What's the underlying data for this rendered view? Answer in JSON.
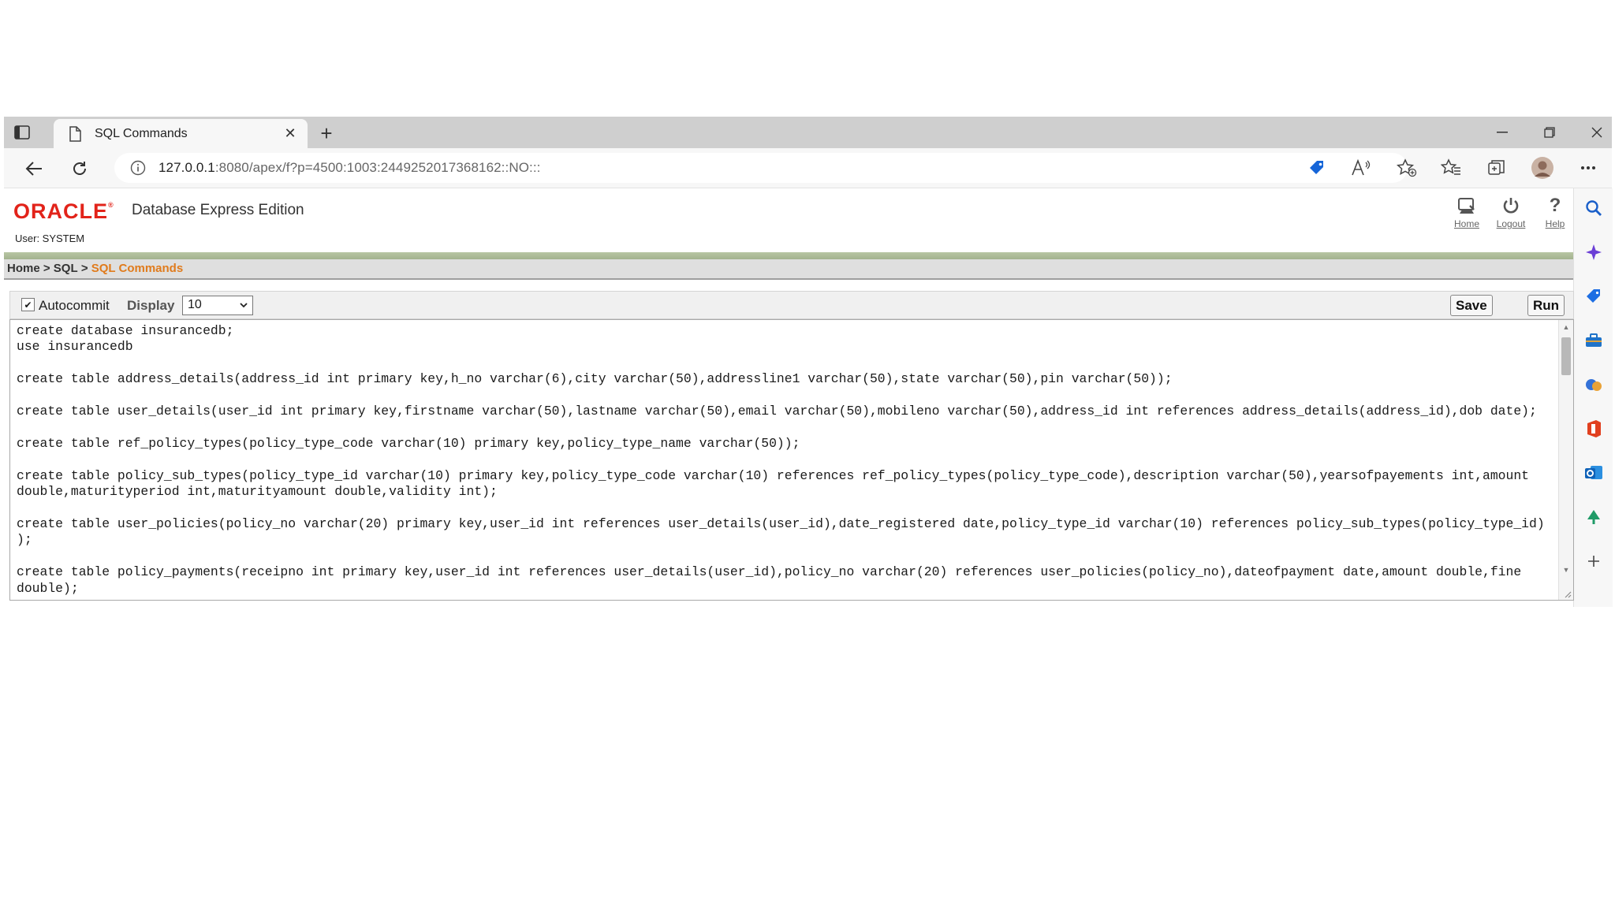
{
  "browser": {
    "tab_title": "SQL Commands",
    "url_host": "127.0.0.1",
    "url_rest": ":8080/apex/f?p=4500:1003:2449252017368162::NO:::"
  },
  "header": {
    "brand": "ORACLE",
    "product": "Database Express Edition",
    "user": "User: SYSTEM",
    "home_label": "Home",
    "logout_label": "Logout",
    "help_label": "Help"
  },
  "breadcrumb": {
    "home": "Home",
    "sep": ">",
    "sql": "SQL",
    "current": "SQL Commands"
  },
  "commands": {
    "autocommit_label": "Autocommit",
    "autocommit_checked": true,
    "display_label": "Display",
    "display_value": "10",
    "save_label": "Save",
    "run_label": "Run"
  },
  "editor": {
    "text": "create database insurancedb;\nuse insurancedb\n\ncreate table address_details(address_id int primary key,h_no varchar(6),city varchar(50),addressline1 varchar(50),state varchar(50),pin varchar(50));\n\ncreate table user_details(user_id int primary key,firstname varchar(50),lastname varchar(50),email varchar(50),mobileno varchar(50),address_id int references address_details(address_id),dob date);\n\ncreate table ref_policy_types(policy_type_code varchar(10) primary key,policy_type_name varchar(50));\n\ncreate table policy_sub_types(policy_type_id varchar(10) primary key,policy_type_code varchar(10) references ref_policy_types(policy_type_code),description varchar(50),yearsofpayements int,amount\ndouble,maturityperiod int,maturityamount double,validity int);\n\ncreate table user_policies(policy_no varchar(20) primary key,user_id int references user_details(user_id),date_registered date,policy_type_id varchar(10) references policy_sub_types(policy_type_id)\n);\n\ncreate table policy_payments(receipno int primary key,user_id int references user_details(user_id),policy_no varchar(20) references user_policies(policy_no),dateofpayment date,amount double,fine\ndouble);"
  }
}
